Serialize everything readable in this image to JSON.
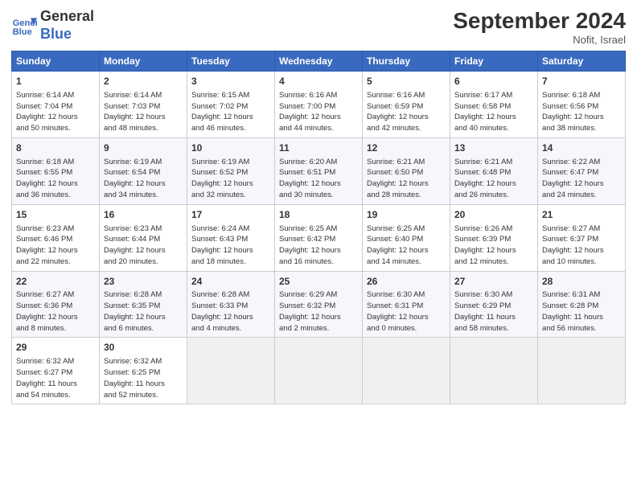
{
  "header": {
    "title": "September 2024",
    "location": "Nofit, Israel",
    "logo_line1": "General",
    "logo_line2": "Blue"
  },
  "days_of_week": [
    "Sunday",
    "Monday",
    "Tuesday",
    "Wednesday",
    "Thursday",
    "Friday",
    "Saturday"
  ],
  "weeks": [
    [
      {
        "day": "1",
        "text": "Sunrise: 6:14 AM\nSunset: 7:04 PM\nDaylight: 12 hours\nand 50 minutes."
      },
      {
        "day": "2",
        "text": "Sunrise: 6:14 AM\nSunset: 7:03 PM\nDaylight: 12 hours\nand 48 minutes."
      },
      {
        "day": "3",
        "text": "Sunrise: 6:15 AM\nSunset: 7:02 PM\nDaylight: 12 hours\nand 46 minutes."
      },
      {
        "day": "4",
        "text": "Sunrise: 6:16 AM\nSunset: 7:00 PM\nDaylight: 12 hours\nand 44 minutes."
      },
      {
        "day": "5",
        "text": "Sunrise: 6:16 AM\nSunset: 6:59 PM\nDaylight: 12 hours\nand 42 minutes."
      },
      {
        "day": "6",
        "text": "Sunrise: 6:17 AM\nSunset: 6:58 PM\nDaylight: 12 hours\nand 40 minutes."
      },
      {
        "day": "7",
        "text": "Sunrise: 6:18 AM\nSunset: 6:56 PM\nDaylight: 12 hours\nand 38 minutes."
      }
    ],
    [
      {
        "day": "8",
        "text": "Sunrise: 6:18 AM\nSunset: 6:55 PM\nDaylight: 12 hours\nand 36 minutes."
      },
      {
        "day": "9",
        "text": "Sunrise: 6:19 AM\nSunset: 6:54 PM\nDaylight: 12 hours\nand 34 minutes."
      },
      {
        "day": "10",
        "text": "Sunrise: 6:19 AM\nSunset: 6:52 PM\nDaylight: 12 hours\nand 32 minutes."
      },
      {
        "day": "11",
        "text": "Sunrise: 6:20 AM\nSunset: 6:51 PM\nDaylight: 12 hours\nand 30 minutes."
      },
      {
        "day": "12",
        "text": "Sunrise: 6:21 AM\nSunset: 6:50 PM\nDaylight: 12 hours\nand 28 minutes."
      },
      {
        "day": "13",
        "text": "Sunrise: 6:21 AM\nSunset: 6:48 PM\nDaylight: 12 hours\nand 26 minutes."
      },
      {
        "day": "14",
        "text": "Sunrise: 6:22 AM\nSunset: 6:47 PM\nDaylight: 12 hours\nand 24 minutes."
      }
    ],
    [
      {
        "day": "15",
        "text": "Sunrise: 6:23 AM\nSunset: 6:46 PM\nDaylight: 12 hours\nand 22 minutes."
      },
      {
        "day": "16",
        "text": "Sunrise: 6:23 AM\nSunset: 6:44 PM\nDaylight: 12 hours\nand 20 minutes."
      },
      {
        "day": "17",
        "text": "Sunrise: 6:24 AM\nSunset: 6:43 PM\nDaylight: 12 hours\nand 18 minutes."
      },
      {
        "day": "18",
        "text": "Sunrise: 6:25 AM\nSunset: 6:42 PM\nDaylight: 12 hours\nand 16 minutes."
      },
      {
        "day": "19",
        "text": "Sunrise: 6:25 AM\nSunset: 6:40 PM\nDaylight: 12 hours\nand 14 minutes."
      },
      {
        "day": "20",
        "text": "Sunrise: 6:26 AM\nSunset: 6:39 PM\nDaylight: 12 hours\nand 12 minutes."
      },
      {
        "day": "21",
        "text": "Sunrise: 6:27 AM\nSunset: 6:37 PM\nDaylight: 12 hours\nand 10 minutes."
      }
    ],
    [
      {
        "day": "22",
        "text": "Sunrise: 6:27 AM\nSunset: 6:36 PM\nDaylight: 12 hours\nand 8 minutes."
      },
      {
        "day": "23",
        "text": "Sunrise: 6:28 AM\nSunset: 6:35 PM\nDaylight: 12 hours\nand 6 minutes."
      },
      {
        "day": "24",
        "text": "Sunrise: 6:28 AM\nSunset: 6:33 PM\nDaylight: 12 hours\nand 4 minutes."
      },
      {
        "day": "25",
        "text": "Sunrise: 6:29 AM\nSunset: 6:32 PM\nDaylight: 12 hours\nand 2 minutes."
      },
      {
        "day": "26",
        "text": "Sunrise: 6:30 AM\nSunset: 6:31 PM\nDaylight: 12 hours\nand 0 minutes."
      },
      {
        "day": "27",
        "text": "Sunrise: 6:30 AM\nSunset: 6:29 PM\nDaylight: 11 hours\nand 58 minutes."
      },
      {
        "day": "28",
        "text": "Sunrise: 6:31 AM\nSunset: 6:28 PM\nDaylight: 11 hours\nand 56 minutes."
      }
    ],
    [
      {
        "day": "29",
        "text": "Sunrise: 6:32 AM\nSunset: 6:27 PM\nDaylight: 11 hours\nand 54 minutes."
      },
      {
        "day": "30",
        "text": "Sunrise: 6:32 AM\nSunset: 6:25 PM\nDaylight: 11 hours\nand 52 minutes."
      },
      {
        "day": "",
        "text": ""
      },
      {
        "day": "",
        "text": ""
      },
      {
        "day": "",
        "text": ""
      },
      {
        "day": "",
        "text": ""
      },
      {
        "day": "",
        "text": ""
      }
    ]
  ]
}
